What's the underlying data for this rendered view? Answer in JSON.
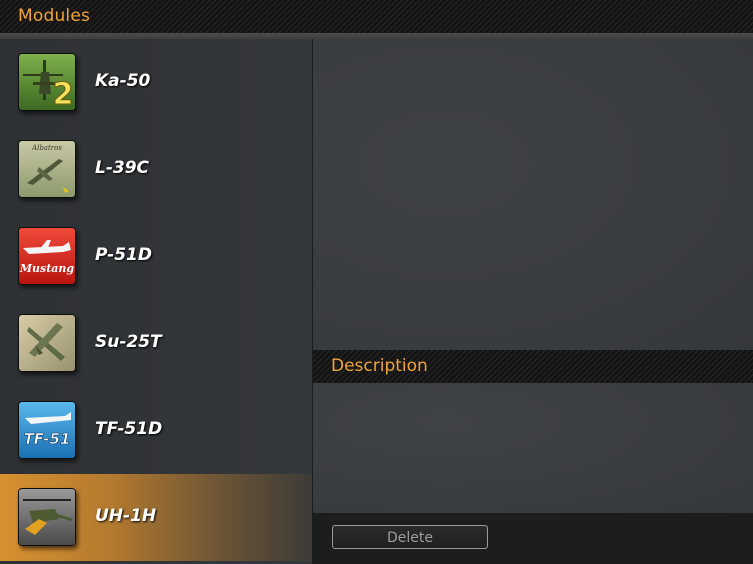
{
  "header": {
    "title": "Modules"
  },
  "modules": [
    {
      "label": "Ka-50",
      "icon": "ka-50-helicopter-icon"
    },
    {
      "label": "L-39C",
      "icon": "l-39c-jet-icon"
    },
    {
      "label": "P-51D",
      "icon": "p-51d-mustang-icon"
    },
    {
      "label": "Su-25T",
      "icon": "su-25t-jet-icon"
    },
    {
      "label": "TF-51D",
      "icon": "tf-51d-icon"
    },
    {
      "label": "UH-1H",
      "icon": "uh-1h-helicopter-icon",
      "selected": true
    }
  ],
  "icon_badges": {
    "ka50": "2",
    "l39": "Albatros",
    "p51": "Mustang",
    "tf51": "TF-51"
  },
  "description": {
    "title": "Description",
    "text": ""
  },
  "footer": {
    "delete_label": "Delete"
  },
  "colors": {
    "accent": "#f0a33a",
    "selected_row": "#d8902f"
  }
}
